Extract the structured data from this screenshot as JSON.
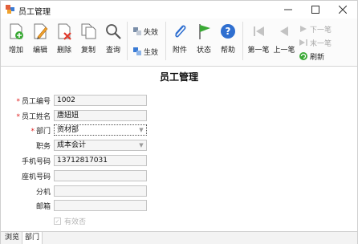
{
  "window": {
    "title": "员工管理",
    "controls": [
      "minimize-icon",
      "maximize-icon",
      "close-icon"
    ]
  },
  "toolbar": {
    "add": {
      "label": "增加",
      "icon": "add-document-icon"
    },
    "edit": {
      "label": "编辑",
      "icon": "edit-document-icon"
    },
    "delete": {
      "label": "删除",
      "icon": "delete-document-icon"
    },
    "copy": {
      "label": "复制",
      "icon": "copy-icon"
    },
    "query": {
      "label": "查询",
      "icon": "search-icon"
    },
    "deactivate": {
      "label": "失效",
      "icon": "deactivate-icon"
    },
    "activate": {
      "label": "生效",
      "icon": "activate-icon"
    },
    "attach": {
      "label": "附件",
      "icon": "paperclip-icon"
    },
    "status": {
      "label": "状态",
      "icon": "flag-icon"
    },
    "help": {
      "label": "帮助",
      "icon": "help-icon"
    },
    "first": {
      "label": "第一笔",
      "icon": "first-record-icon",
      "enabled": false
    },
    "prev": {
      "label": "上一笔",
      "icon": "previous-record-icon",
      "enabled": false
    },
    "next": {
      "label": "下一笔",
      "icon": "next-record-icon",
      "enabled": false
    },
    "last": {
      "label": "末一笔",
      "icon": "last-record-icon",
      "enabled": false
    },
    "refresh": {
      "label": "刷新",
      "icon": "refresh-icon"
    }
  },
  "form": {
    "title": "员工管理",
    "required_marker": "*",
    "fields": {
      "emp_no": {
        "label": "员工编号",
        "value": "1002",
        "required": true
      },
      "emp_name": {
        "label": "员工姓名",
        "value": "唐妞妞",
        "required": true
      },
      "department": {
        "label": "部门",
        "value": "资材部",
        "required": true
      },
      "position": {
        "label": "职务",
        "value": "成本会计"
      },
      "mobile": {
        "label": "手机号码",
        "value": "13712817031"
      },
      "landline": {
        "label": "座机号码",
        "value": ""
      },
      "extension": {
        "label": "分机",
        "value": ""
      },
      "email": {
        "label": "邮箱",
        "value": ""
      }
    },
    "checkbox": {
      "label": "有效否",
      "checked": true,
      "enabled": false
    }
  },
  "tabs": [
    {
      "label": "浏览",
      "active": false
    },
    {
      "label": "部门",
      "active": true
    }
  ],
  "colors": {
    "required": "#e02020",
    "disabled_text": "#a9a9a9",
    "accent_blue": "#2f6fd0",
    "accent_green": "#3aa935"
  }
}
